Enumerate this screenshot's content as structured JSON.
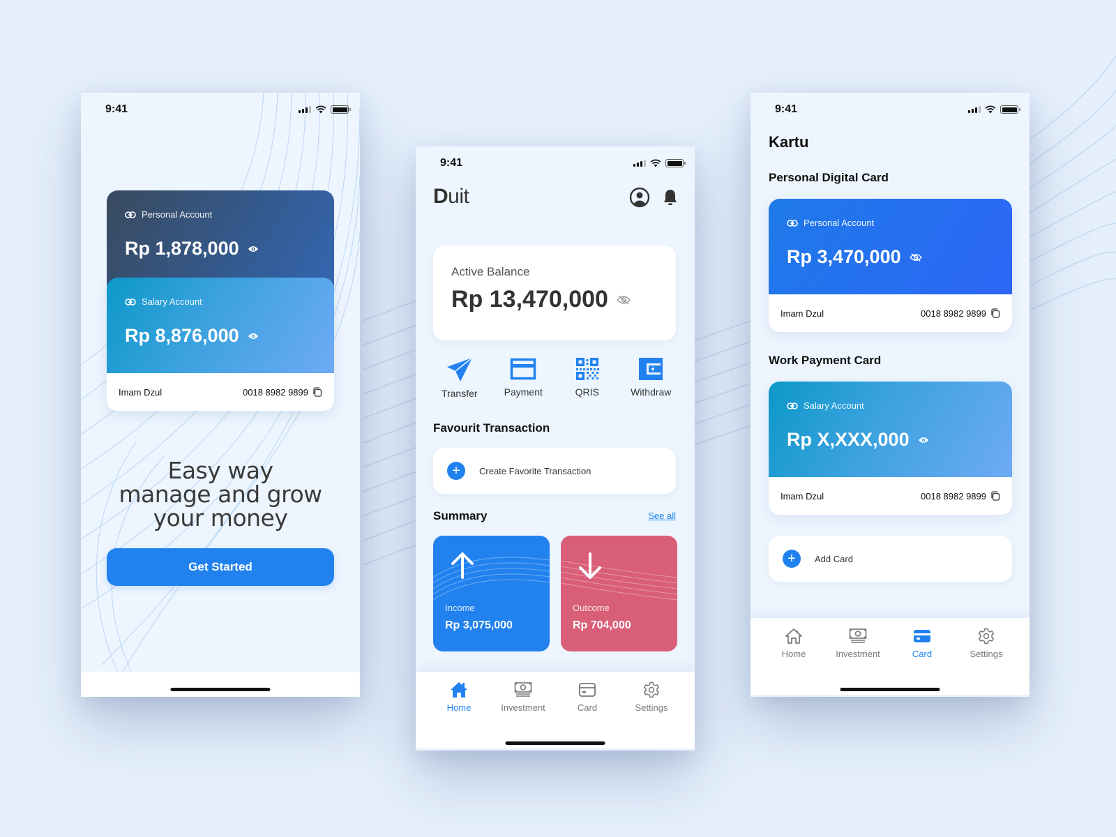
{
  "colors": {
    "primary": "#2182ef",
    "outcome": "#d95f78",
    "background": "#e6f0fc",
    "screen": "#edf5fe"
  },
  "status": {
    "time": "9:41"
  },
  "onboarding": {
    "cards": [
      {
        "label": "Personal Account",
        "amount": "Rp 1,878,000",
        "icon": "link-icon",
        "visibility_icon": "eye-icon"
      },
      {
        "label": "Salary Account",
        "amount": "Rp 8,876,000",
        "icon": "link-icon",
        "visibility_icon": "eye-icon",
        "holder": "Imam Dzul",
        "number": "0018 8982 9899"
      }
    ],
    "headline": [
      "Easy way",
      "manage and grow",
      "your money"
    ],
    "cta_label": "Get Started"
  },
  "home": {
    "brand": {
      "first": "D",
      "rest": "uit"
    },
    "header_icons": [
      "profile-icon",
      "bell-icon"
    ],
    "balance": {
      "label": "Active Balance",
      "amount": "Rp 13,470,000",
      "visibility_icon": "eye-off-icon"
    },
    "actions": [
      {
        "label": "Transfer",
        "icon": "paper-plane-icon"
      },
      {
        "label": "Payment",
        "icon": "credit-card-icon"
      },
      {
        "label": "QRIS",
        "icon": "qr-code-icon"
      },
      {
        "label": "Withdraw",
        "icon": "wallet-icon"
      }
    ],
    "favourite": {
      "title": "Favourit Transaction",
      "create_label": "Create Favorite Transaction"
    },
    "summary": {
      "title": "Summary",
      "see_all": "See all",
      "income": {
        "label": "Income",
        "amount": "Rp 3,075,000",
        "icon": "arrow-up-icon"
      },
      "outcome": {
        "label": "Outcome",
        "amount": "Rp 704,000",
        "icon": "arrow-down-icon"
      }
    }
  },
  "cards_page": {
    "title": "Kartu",
    "sections": [
      {
        "title": "Personal Digital Card",
        "card": {
          "label": "Personal Account",
          "amount": "Rp 3,470,000",
          "visibility_icon": "eye-off-icon",
          "holder": "Imam Dzul",
          "number": "0018 8982 9899"
        }
      },
      {
        "title": "Work Payment Card",
        "card": {
          "label": "Salary Account",
          "amount": "Rp X,XXX,000",
          "visibility_icon": "eye-icon",
          "holder": "Imam Dzul",
          "number": "0018 8982 9899"
        }
      }
    ],
    "add_label": "Add Card"
  },
  "tabbar": {
    "items": [
      {
        "label": "Home",
        "icon": "home-icon"
      },
      {
        "label": "Investment",
        "icon": "money-icon"
      },
      {
        "label": "Card",
        "icon": "card-icon"
      },
      {
        "label": "Settings",
        "icon": "gear-icon"
      }
    ],
    "home_active": "Home",
    "cards_active": "Card"
  }
}
